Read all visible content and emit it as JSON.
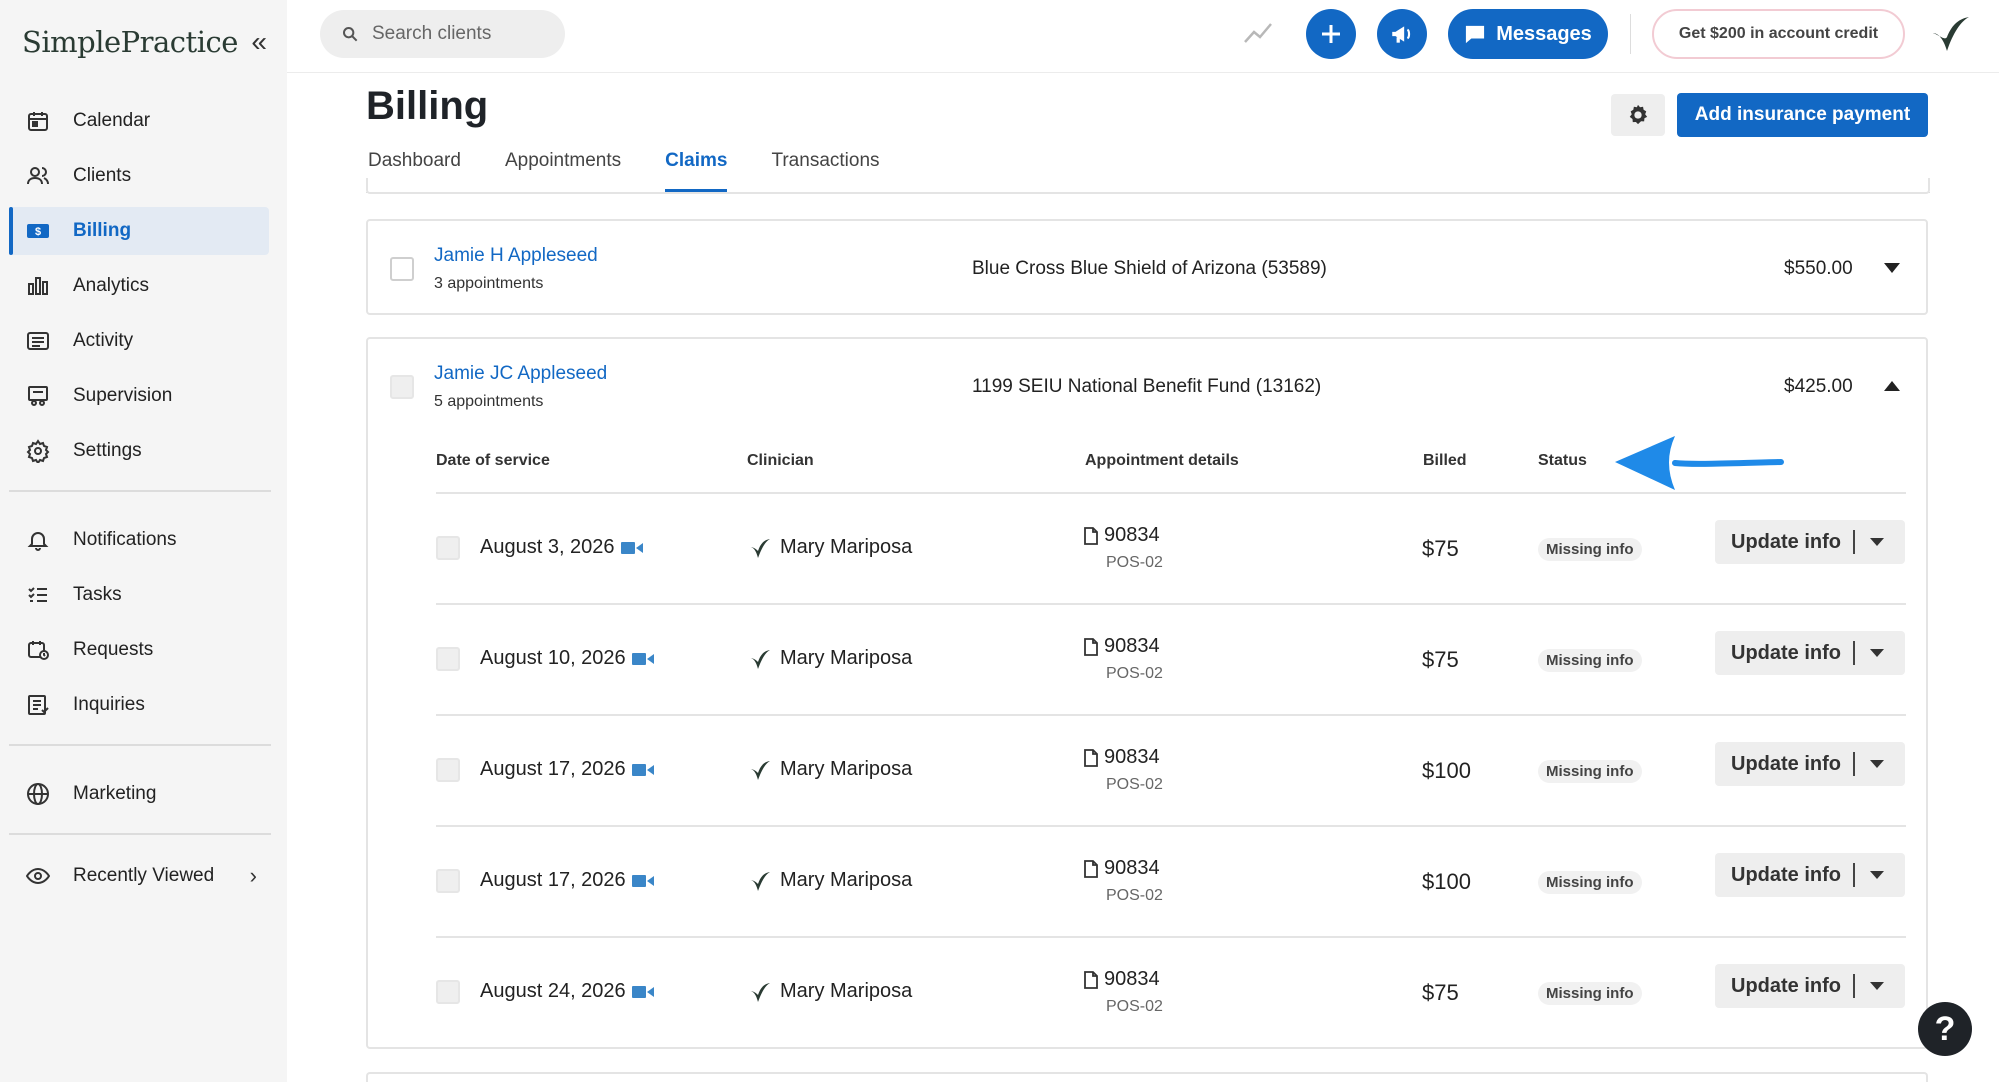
{
  "app": {
    "logo_text": "SimplePractice",
    "collapse_glyph": "«"
  },
  "sidebar": {
    "items": [
      {
        "label": "Calendar",
        "icon": "calendar-icon",
        "active": false
      },
      {
        "label": "Clients",
        "icon": "clients-icon",
        "active": false
      },
      {
        "label": "Billing",
        "icon": "billing-icon",
        "active": true
      },
      {
        "label": "Analytics",
        "icon": "analytics-icon",
        "active": false
      },
      {
        "label": "Activity",
        "icon": "activity-icon",
        "active": false
      },
      {
        "label": "Supervision",
        "icon": "supervision-icon",
        "active": false
      },
      {
        "label": "Settings",
        "icon": "settings-icon",
        "active": false
      },
      {
        "label": "Notifications",
        "icon": "bell-icon",
        "active": false
      },
      {
        "label": "Tasks",
        "icon": "tasks-icon",
        "active": false
      },
      {
        "label": "Requests",
        "icon": "requests-icon",
        "active": false
      },
      {
        "label": "Inquiries",
        "icon": "inquiries-icon",
        "active": false
      },
      {
        "label": "Marketing",
        "icon": "globe-icon",
        "active": false
      },
      {
        "label": "Recently Viewed",
        "icon": "eye-icon",
        "active": false
      }
    ]
  },
  "topbar": {
    "search_placeholder": "Search clients",
    "messages_label": "Messages",
    "credit_label": "Get $200 in account credit"
  },
  "page": {
    "title": "Billing",
    "add_payment_label": "Add insurance payment",
    "tabs": [
      {
        "label": "Dashboard",
        "active": false
      },
      {
        "label": "Appointments",
        "active": false
      },
      {
        "label": "Claims",
        "active": true
      },
      {
        "label": "Transactions",
        "active": false
      }
    ]
  },
  "claims": [
    {
      "client": "Jamie H Appleseed",
      "appointments": "3 appointments",
      "payer": "Blue Cross Blue Shield of Arizona (53589)",
      "amount": "$550.00",
      "expanded": false
    },
    {
      "client": "Jamie JC Appleseed",
      "appointments": "5 appointments",
      "payer": "1199 SEIU National Benefit Fund (13162)",
      "amount": "$425.00",
      "expanded": true
    }
  ],
  "table": {
    "headers": [
      "Date of service",
      "Clinician",
      "Appointment details",
      "Billed",
      "Status"
    ],
    "rows": [
      {
        "date": "August 3, 2026",
        "clinician": "Mary Mariposa",
        "code": "90834",
        "pos": "POS-02",
        "billed": "$75",
        "status": "Missing info",
        "action": "Update info"
      },
      {
        "date": "August 10, 2026",
        "clinician": "Mary Mariposa",
        "code": "90834",
        "pos": "POS-02",
        "billed": "$75",
        "status": "Missing info",
        "action": "Update info"
      },
      {
        "date": "August 17, 2026",
        "clinician": "Mary Mariposa",
        "code": "90834",
        "pos": "POS-02",
        "billed": "$100",
        "status": "Missing info",
        "action": "Update info"
      },
      {
        "date": "August 17, 2026",
        "clinician": "Mary Mariposa",
        "code": "90834",
        "pos": "POS-02",
        "billed": "$100",
        "status": "Missing info",
        "action": "Update info"
      },
      {
        "date": "August 24, 2026",
        "clinician": "Mary Mariposa",
        "code": "90834",
        "pos": "POS-02",
        "billed": "$75",
        "status": "Missing info",
        "action": "Update info"
      }
    ]
  },
  "help_glyph": "?",
  "colors": {
    "accent": "#1268c4",
    "sidebar_bg": "#f5f5f5",
    "active_bg": "#e3eaf3",
    "brand_dark": "#2a3b33"
  }
}
